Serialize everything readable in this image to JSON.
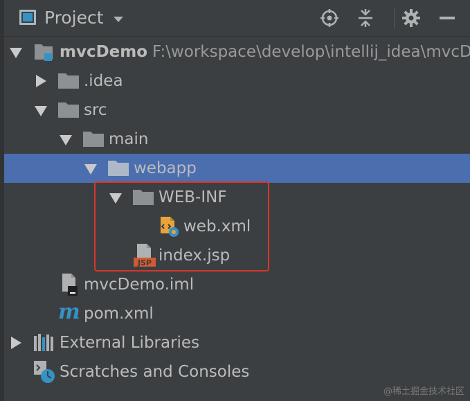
{
  "header": {
    "title": "Project",
    "icons": [
      "project-view-icon",
      "dropdown-arrow-icon",
      "locate-icon",
      "collapse-all-icon",
      "settings-gear-icon",
      "hide-icon"
    ]
  },
  "tree": {
    "root": {
      "label": "mvcDemo",
      "path": "F:\\workspace\\develop\\intellij_idea\\mvcDemo"
    },
    "idea": {
      "label": ".idea"
    },
    "src": {
      "label": "src"
    },
    "main": {
      "label": "main"
    },
    "webapp": {
      "label": "webapp"
    },
    "webinf": {
      "label": "WEB-INF"
    },
    "webxml": {
      "label": "web.xml"
    },
    "indexjsp": {
      "label": "index.jsp",
      "badge": "JSP"
    },
    "iml": {
      "label": "mvcDemo.iml"
    },
    "pom": {
      "label": "pom.xml",
      "badge": "m"
    },
    "extlibs": {
      "label": "External Libraries"
    },
    "scratches": {
      "label": "Scratches and Consoles"
    }
  },
  "watermark": "@稀土掘金技术社区",
  "colors": {
    "background": "#3c3f41",
    "selection": "#4b6eaf",
    "highlight_border": "#d9352c",
    "text": "#bbbbbb",
    "folder": "#8d9194"
  }
}
